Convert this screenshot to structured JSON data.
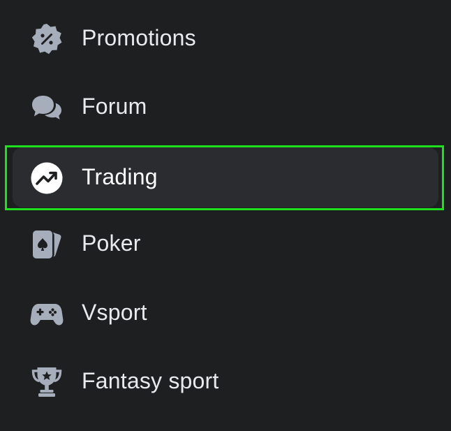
{
  "menu": {
    "items": [
      {
        "label": "Promotions",
        "icon": "promotions-badge-icon",
        "active": false
      },
      {
        "label": "Forum",
        "icon": "chat-bubbles-icon",
        "active": false
      },
      {
        "label": "Trading",
        "icon": "trending-up-icon",
        "active": true
      },
      {
        "label": "Poker",
        "icon": "playing-cards-icon",
        "active": false
      },
      {
        "label": "Vsport",
        "icon": "gamepad-icon",
        "active": false
      },
      {
        "label": "Fantasy sport",
        "icon": "trophy-icon",
        "active": false
      }
    ]
  },
  "colors": {
    "background": "#1e1f21",
    "active_background": "#2b2c2f",
    "icon_color": "#a6adbb",
    "active_icon_color": "#ffffff",
    "text_color": "#e9eaee",
    "highlight_border": "#1ee01e"
  }
}
